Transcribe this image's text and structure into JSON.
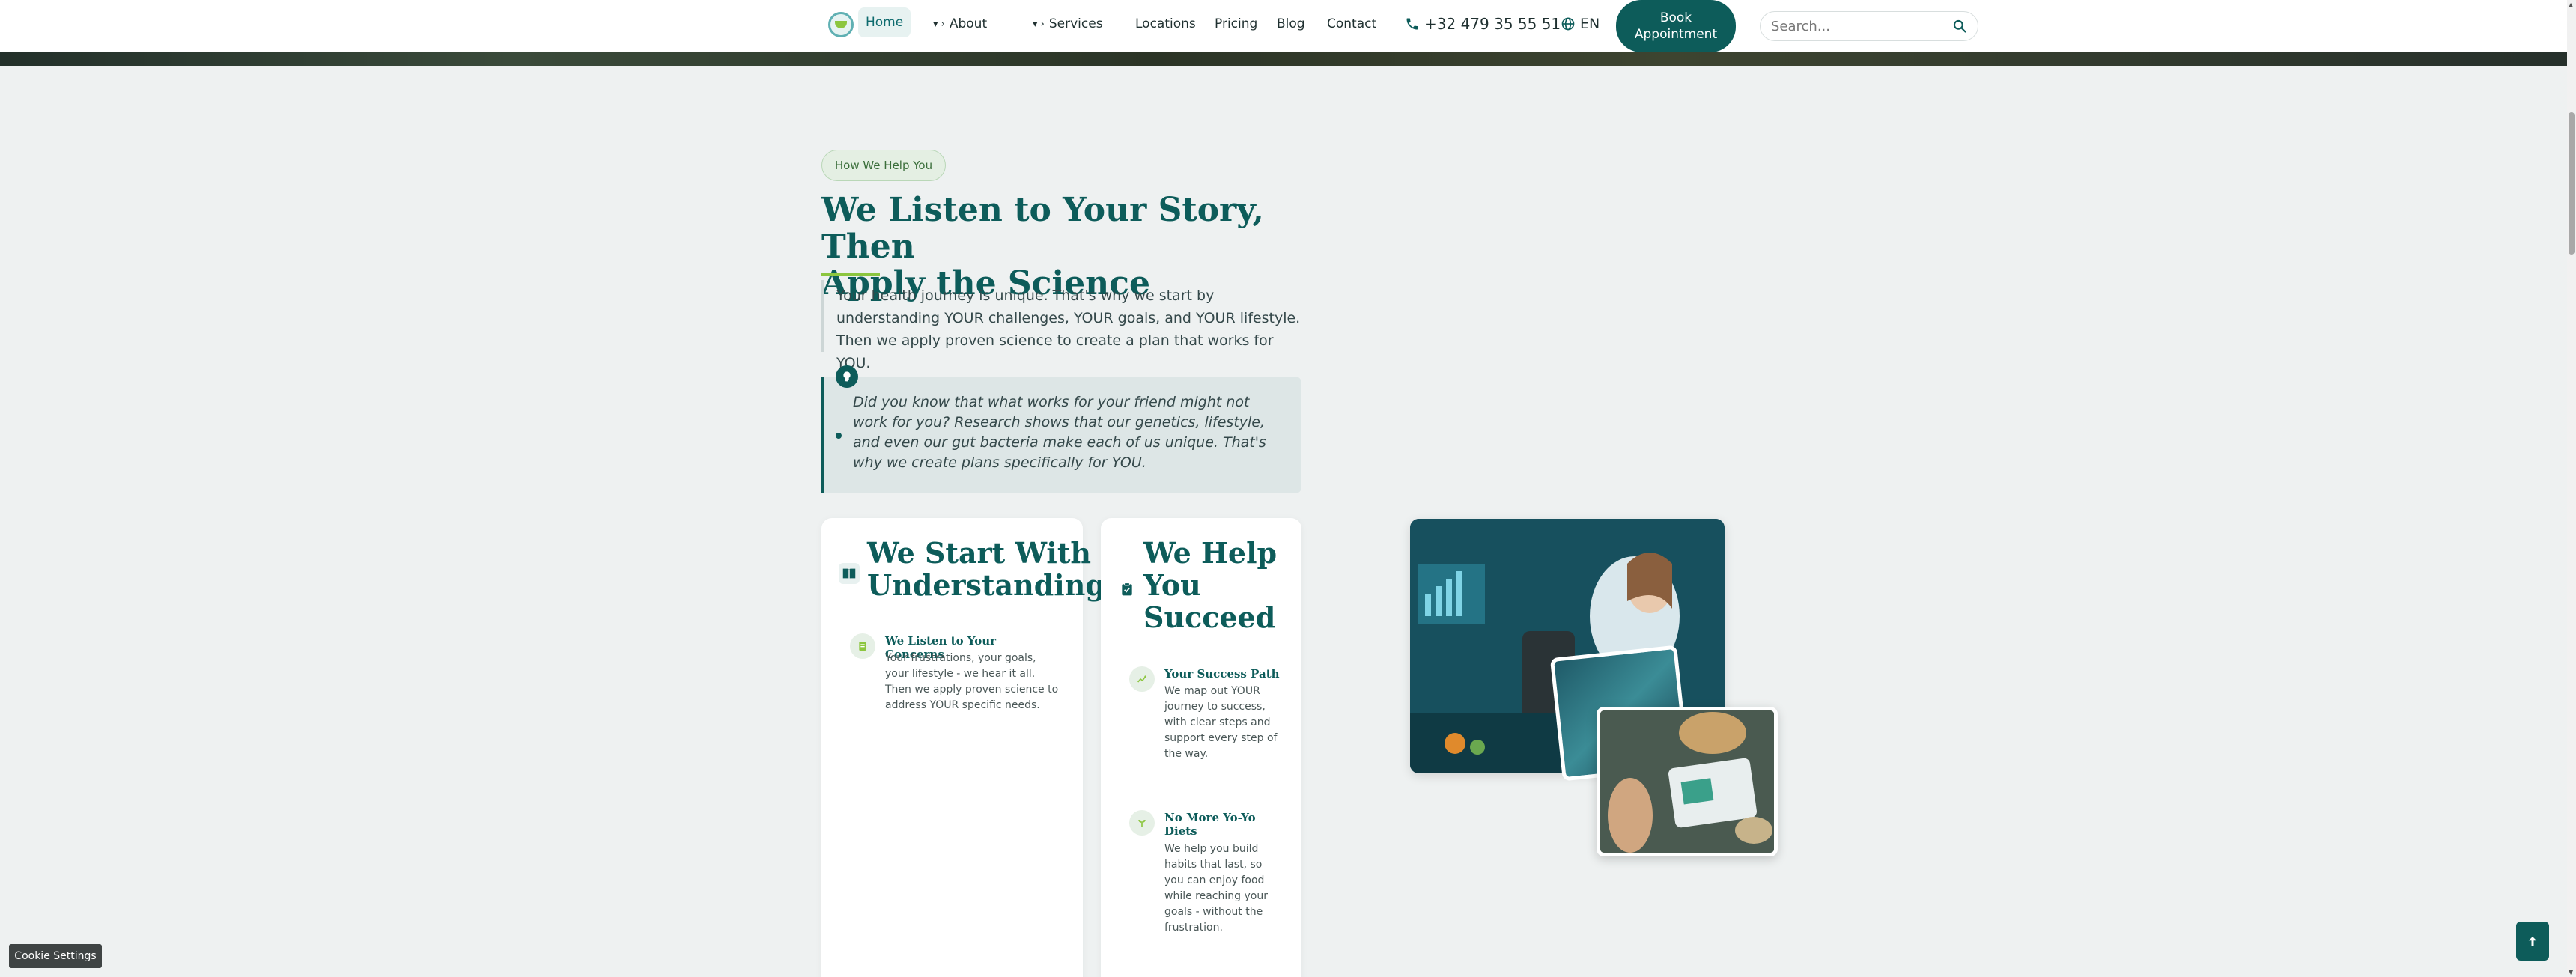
{
  "header": {
    "nav": {
      "home": "Home",
      "about": "About",
      "services": "Services",
      "locations": "Locations",
      "pricing": "Pricing",
      "blog": "Blog",
      "contact": "Contact"
    },
    "caret": "▾ ›",
    "phone": "+32 479 35 55 51",
    "language": "EN",
    "book_line1": "Book",
    "book_line2": "Appointment",
    "search_placeholder": "Search..."
  },
  "section": {
    "pill": "How We Help You",
    "title_line1": "We Listen to Your Story, Then",
    "title_line2": "Apply the Science",
    "intro": "Your health journey is unique. That's why we start by understanding YOUR challenges, YOUR goals, and YOUR lifestyle. Then we apply proven science to create a plan that works for YOU.",
    "quote": "Did you know that what works for your friend might not work for you? Research shows that our genetics, lifestyle, and even our gut bacteria make each of us unique. That's why we create plans specifically for YOU."
  },
  "card_understanding": {
    "title_line1": "We Start With",
    "title_line2": "Understanding",
    "feature": {
      "title": "We Listen to Your Concerns",
      "body": "Your frustrations, your goals, your lifestyle - we hear it all. Then we apply proven science to address YOUR specific needs."
    }
  },
  "card_succeed": {
    "title_line1": "We Help",
    "title_line2": "You",
    "title_line3": "Succeed",
    "features": [
      {
        "title": "Your Success Path",
        "body": "We map out YOUR journey to success, with clear steps and support every step of the way."
      },
      {
        "title": "No More Yo-Yo Diets",
        "body": "We help you build habits that last, so you can enjoy food while reaching your goals - without the frustration."
      }
    ]
  },
  "cookie_label": "Cookie Settings",
  "colors": {
    "primary": "#0d5c5a",
    "accent": "#8cc63f",
    "background": "#eef1f1"
  },
  "icons": {
    "phone": "phone-icon",
    "language": "globe-icon",
    "search": "search-icon",
    "badge": "lightbulb-icon",
    "card1": "book-icon",
    "card2": "clipboard-check-icon",
    "feature1": "notes-icon",
    "feature2": "chart-icon",
    "feature3": "sprout-icon",
    "to_top": "arrow-up-icon"
  }
}
